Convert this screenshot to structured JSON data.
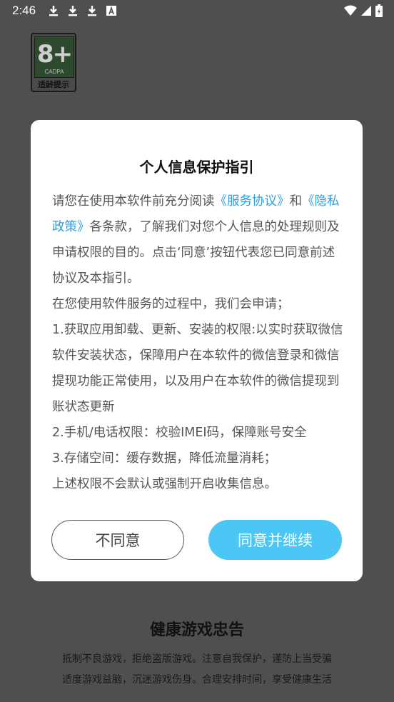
{
  "status_bar": {
    "time": "2:46",
    "left_icons": [
      "download-icon",
      "download-icon",
      "download-icon",
      "font-icon"
    ],
    "right_icons": [
      "wifi-icon",
      "signal-icon",
      "battery-icon"
    ]
  },
  "age_badge": {
    "rating": "8+",
    "org": "CADPA",
    "label": "适龄提示"
  },
  "dialog": {
    "title": "个人信息保护指引",
    "para1_pre": "请您在使用本软件前充分阅读",
    "link_service": "《服务协议》",
    "para1_and": "和",
    "link_privacy": "《隐私政策》",
    "para1_post": "各条款，了解我们对您个人信息的处理规则及申请权限的目的。点击‘同意’按钮代表您已同意前述协议及本指引。",
    "para2": "在您使用软件服务的过程中，我们会申请；",
    "para3": "1.获取应用卸载、更新、安装的权限:以实时获取微信软件安装状态，保障用户在本软件的微信登录和微信提现功能正常使用，以及用户在本软件的微信提现到账状态更新",
    "para4": "2.手机/电话权限：校验IMEI码，保障账号安全",
    "para5": "3.存储空间：缓存数据，降低流量消耗；",
    "para6": "上述权限不会默认或强制开启收集信息。",
    "disagree_label": "不同意",
    "agree_label": "同意并继续"
  },
  "advice": {
    "title": "健康游戏忠告",
    "line1": "抵制不良游戏，拒绝盗版游戏。注意自我保护，谨防上当受骗",
    "line2": "适度游戏益脑，沉迷游戏伤身。合理安排时间，享受健康生活"
  },
  "colors": {
    "overlay_bg": "#4f4f4f",
    "link": "#2f9de0",
    "agree_button": "#4cc7f5"
  }
}
